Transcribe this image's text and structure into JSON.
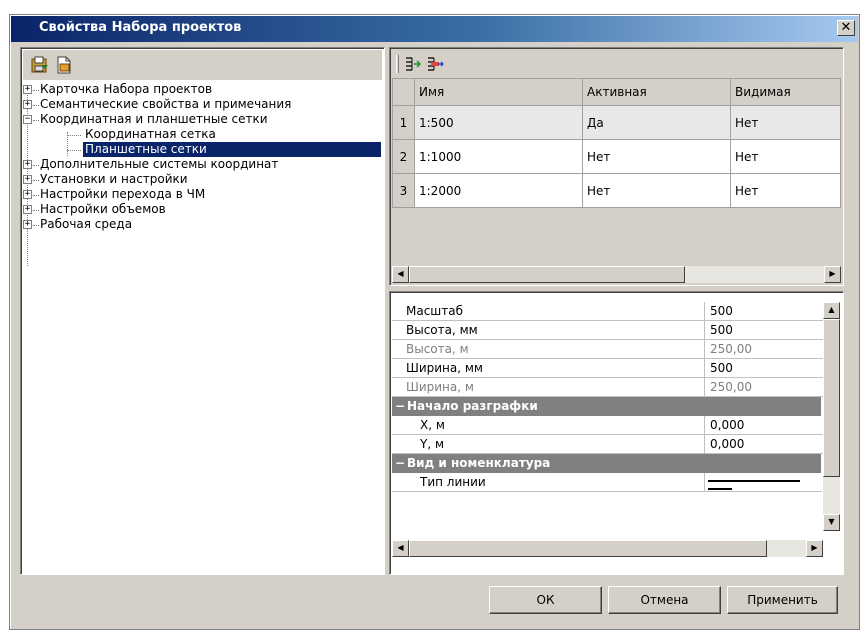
{
  "window": {
    "title": "Свойства Набора проектов",
    "close_glyph": "✕"
  },
  "tree": {
    "items": [
      {
        "label": "Карточка Набора проектов",
        "expander": "+"
      },
      {
        "label": "Семантические свойства и примечания",
        "expander": "+"
      },
      {
        "label": "Координатная и планшетные сетки",
        "expander": "−"
      },
      {
        "label": "Координатная сетка"
      },
      {
        "label": "Планшетные сетки",
        "selected": true
      },
      {
        "label": "Дополнительные системы координат",
        "expander": "+"
      },
      {
        "label": "Установки и настройки",
        "expander": "+"
      },
      {
        "label": "Настройки перехода в ЧМ",
        "expander": "+"
      },
      {
        "label": "Настройки объемов",
        "expander": "+"
      },
      {
        "label": "Рабочая среда",
        "expander": "+"
      }
    ]
  },
  "grid": {
    "columns": [
      "Имя",
      "Активная",
      "Видимая"
    ],
    "rows": [
      {
        "num": "1",
        "name": "1:500",
        "active": "Да",
        "visible": "Нет"
      },
      {
        "num": "2",
        "name": "1:1000",
        "active": "Нет",
        "visible": "Нет"
      },
      {
        "num": "3",
        "name": "1:2000",
        "active": "Нет",
        "visible": "Нет"
      }
    ]
  },
  "properties": {
    "rows": [
      {
        "name": "Масштаб",
        "value": "500"
      },
      {
        "name": "Высота, мм",
        "value": "500"
      },
      {
        "name": "Высота, м",
        "value": "250,00",
        "disabled": true
      },
      {
        "name": "Ширина, мм",
        "value": "500"
      },
      {
        "name": "Ширина, м",
        "value": "250,00",
        "disabled": true
      }
    ],
    "cat1": {
      "label": "Начало разграфки",
      "toggle": "−"
    },
    "cat1_rows": [
      {
        "name": "X, м",
        "value": "0,000"
      },
      {
        "name": "Y, м",
        "value": "0,000"
      }
    ],
    "cat2": {
      "label": "Вид и номенклатура",
      "toggle": "−"
    },
    "cat2_rows": [
      {
        "name": "Тип линии",
        "value": ""
      }
    ]
  },
  "buttons": {
    "ok": "ОК",
    "cancel": "Отмена",
    "apply": "Применить"
  },
  "scroll_glyphs": {
    "left": "◀",
    "right": "▶",
    "up": "▲",
    "down": "▼"
  }
}
